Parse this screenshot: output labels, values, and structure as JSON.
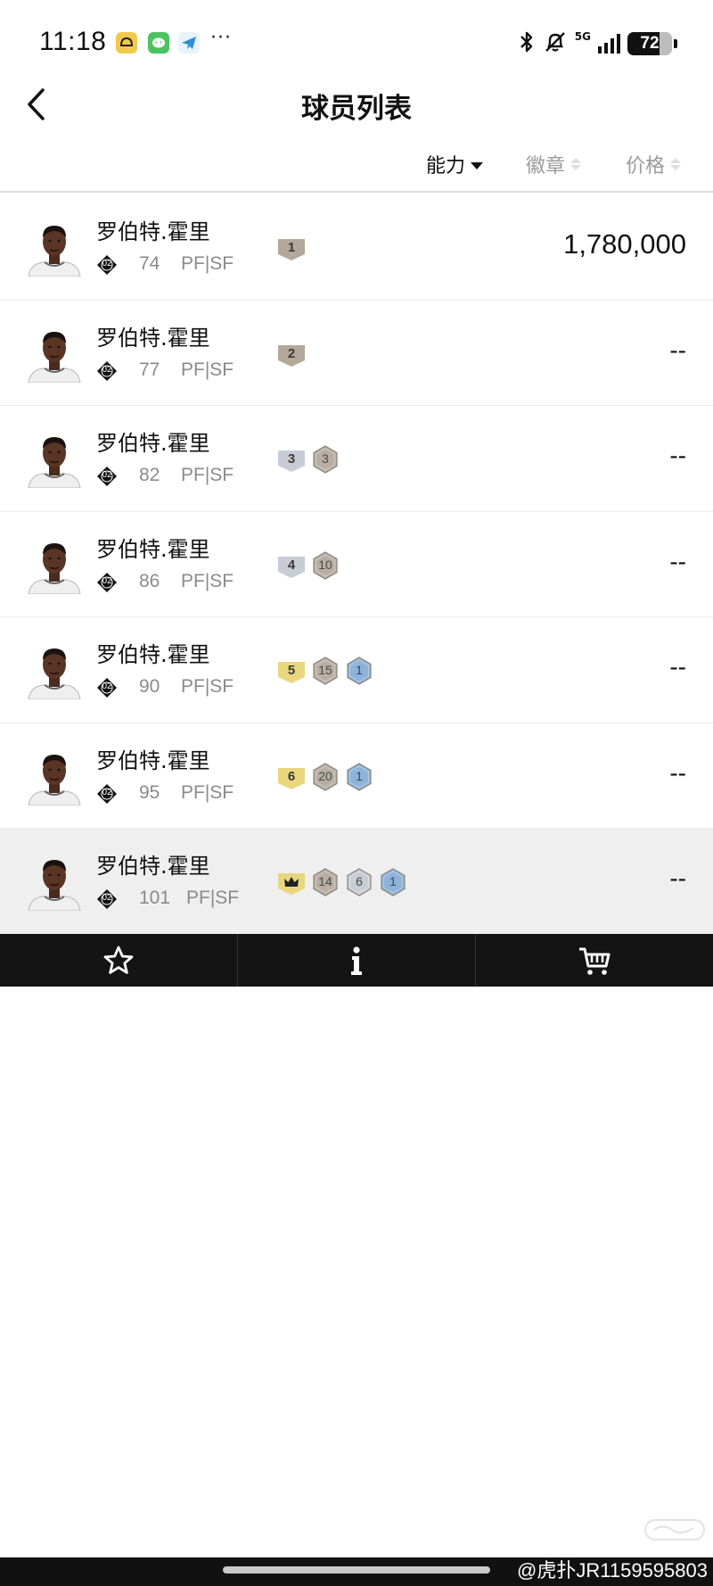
{
  "status_bar": {
    "time": "11:18",
    "dots": "···",
    "network": "5G",
    "battery": "72",
    "battery_level": 0.72
  },
  "header": {
    "title": "球员列表",
    "back_icon": "chevron-left-icon"
  },
  "sort_bar": {
    "items": [
      {
        "label": "能力",
        "state": "active-desc"
      },
      {
        "label": "徽章",
        "state": "inactive"
      },
      {
        "label": "价格",
        "state": "inactive"
      }
    ]
  },
  "players": [
    {
      "name": "罗伯特.霍里",
      "tier": "02",
      "rating": "74",
      "position": "PF|SF",
      "price": "1,780,000",
      "badges": [
        {
          "text": "1",
          "kind": "tag",
          "color": "#b3a89a",
          "fg": "#3a3a3a"
        }
      ]
    },
    {
      "name": "罗伯特.霍里",
      "tier": "02",
      "rating": "77",
      "position": "PF|SF",
      "price": "--",
      "badges": [
        {
          "text": "2",
          "kind": "tag",
          "color": "#b3a89a",
          "fg": "#3a3a3a"
        }
      ]
    },
    {
      "name": "罗伯特.霍里",
      "tier": "02",
      "rating": "82",
      "position": "PF|SF",
      "price": "--",
      "badges": [
        {
          "text": "3",
          "kind": "tag",
          "color": "#c8ccd4",
          "fg": "#3a3a3a"
        },
        {
          "text": "3",
          "kind": "hex",
          "color": "#b8aea4",
          "fg": "#4a4a4a"
        }
      ]
    },
    {
      "name": "罗伯特.霍里",
      "tier": "02",
      "rating": "86",
      "position": "PF|SF",
      "price": "--",
      "badges": [
        {
          "text": "4",
          "kind": "tag",
          "color": "#c8ccd4",
          "fg": "#3a3a3a"
        },
        {
          "text": "10",
          "kind": "hex",
          "color": "#b8aea4",
          "fg": "#4a4a4a"
        }
      ]
    },
    {
      "name": "罗伯特.霍里",
      "tier": "02",
      "rating": "90",
      "position": "PF|SF",
      "price": "--",
      "badges": [
        {
          "text": "5",
          "kind": "tag",
          "color": "#e8d77e",
          "fg": "#3a3a3a"
        },
        {
          "text": "15",
          "kind": "hex",
          "color": "#b8aea4",
          "fg": "#4a4a4a"
        },
        {
          "text": "1",
          "kind": "hex",
          "color": "#8fb2d8",
          "fg": "#2f4a6a"
        }
      ]
    },
    {
      "name": "罗伯特.霍里",
      "tier": "02",
      "rating": "95",
      "position": "PF|SF",
      "price": "--",
      "badges": [
        {
          "text": "6",
          "kind": "tag",
          "color": "#e8d77e",
          "fg": "#3a3a3a"
        },
        {
          "text": "20",
          "kind": "hex",
          "color": "#b8aea4",
          "fg": "#4a4a4a"
        },
        {
          "text": "1",
          "kind": "hex",
          "color": "#8fb2d8",
          "fg": "#2f4a6a"
        }
      ]
    },
    {
      "name": "罗伯特.霍里",
      "tier": "02",
      "rating": "101",
      "position": "PF|SF",
      "price": "--",
      "badges": [
        {
          "text": "",
          "kind": "crown",
          "color": "#e8d77e",
          "fg": "#3a3a3a"
        },
        {
          "text": "14",
          "kind": "hex",
          "color": "#b8aea4",
          "fg": "#4a4a4a"
        },
        {
          "text": "6",
          "kind": "hex",
          "color": "#c8ccd4",
          "fg": "#4a4a4a"
        },
        {
          "text": "1",
          "kind": "hex",
          "color": "#8fb2d8",
          "fg": "#2f4a6a"
        }
      ]
    }
  ],
  "toolbar": {
    "buttons": [
      {
        "icon": "star-icon"
      },
      {
        "icon": "info-icon"
      },
      {
        "icon": "cart-icon"
      }
    ]
  },
  "watermark": {
    "text": "@虎扑JR1159595803"
  }
}
